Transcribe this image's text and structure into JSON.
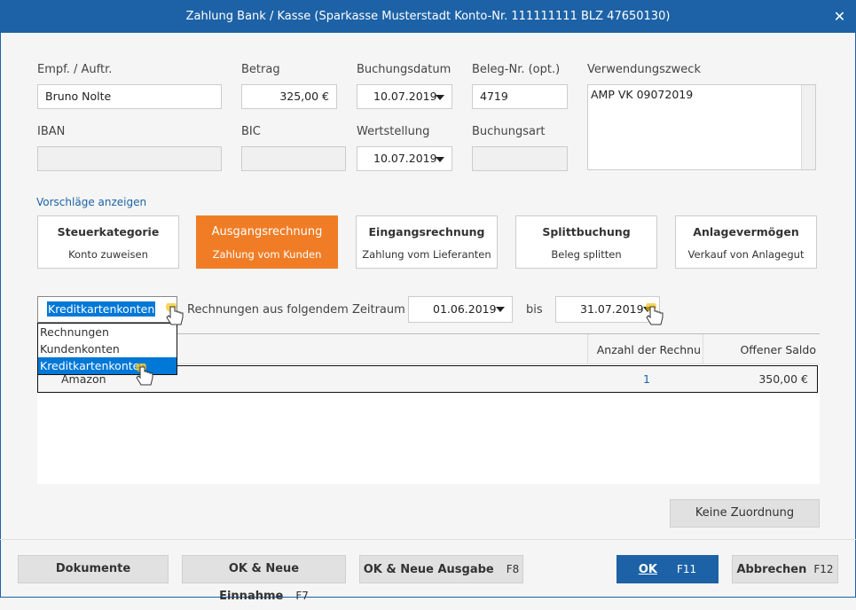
{
  "window": {
    "title": "Zahlung Bank / Kasse (Sparkasse Musterstadt Konto-Nr. 111111111  BLZ 47650130)",
    "close": "✕"
  },
  "form": {
    "empf_label": "Empf. / Auftr.",
    "empf_value": "Bruno Nolte",
    "betrag_label": "Betrag",
    "betrag_value": "325,00 €",
    "buchungsdatum_label": "Buchungsdatum",
    "buchungsdatum_value": "10.07.2019",
    "beleg_label": "Beleg-Nr. (opt.)",
    "beleg_value": "4719",
    "verwendung_label": "Verwendungszweck",
    "verwendung_value": "AMP VK 09072019",
    "iban_label": "IBAN",
    "iban_value": "",
    "bic_label": "BIC",
    "bic_value": "",
    "wertstellung_label": "Wertstellung",
    "wertstellung_value": "10.07.2019",
    "buchungsart_label": "Buchungsart",
    "buchungsart_value": ""
  },
  "suggestions_link": "Vorschläge anzeigen",
  "tiles": [
    {
      "title": "Steuerkategorie",
      "sub": "Konto zuweisen"
    },
    {
      "title": "Ausgangsrechnung",
      "sub": "Zahlung vom Kunden"
    },
    {
      "title": "Eingangsrechnung",
      "sub": "Zahlung vom Lieferanten"
    },
    {
      "title": "Splittbuchung",
      "sub": "Beleg splitten"
    },
    {
      "title": "Anlagevermögen",
      "sub": "Verkauf von Anlagegut"
    }
  ],
  "filter": {
    "selected": "Kreditkartenkonten",
    "options": [
      "Rechnungen",
      "Kundenkonten",
      "Kreditkartenkonten"
    ],
    "period_label": "Rechnungen aus folgendem Zeitraum",
    "from": "01.06.2019",
    "bis": "bis",
    "to": "31.07.2019"
  },
  "table": {
    "columns": [
      "",
      "Anzahl der Rechnu",
      "Offener Saldo"
    ],
    "rows": [
      {
        "name": "Amazon",
        "count": "1",
        "saldo": "350,00 €"
      }
    ]
  },
  "keine_zuordnung": "Keine Zuordnung",
  "footer": {
    "dokumente": "Dokumente",
    "ok_einnahme": "OK & Neue Einnahme",
    "ok_einnahme_key": "F7",
    "ok_ausgabe": "OK & Neue Ausgabe",
    "ok_ausgabe_key": "F8",
    "ok": "OK",
    "ok_key": "F11",
    "abbrechen": "Abbrechen",
    "abbrechen_key": "F12"
  },
  "colors": {
    "titlebar": "#1d62a6",
    "accent": "#f07d26",
    "selection": "#0078d7"
  }
}
